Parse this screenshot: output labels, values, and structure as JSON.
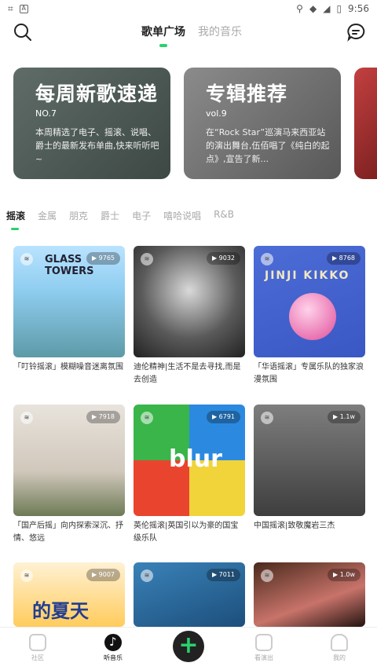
{
  "status": {
    "time": "9:56"
  },
  "header": {
    "tabs": [
      {
        "label": "歌单广场"
      },
      {
        "label": "我的音乐"
      }
    ]
  },
  "banners": [
    {
      "title": "每周新歌速递",
      "no": "NO.7",
      "desc": "本周精选了电子、摇滚、说唱、爵士的最新发布单曲,快来听听吧~"
    },
    {
      "title": "专辑推荐",
      "no": "vol.9",
      "desc": "在“Rock Star”巡演马来西亚站的演出舞台,伍佰唱了《纯白的起点》,宣告了新..."
    }
  ],
  "genres": [
    "摇滚",
    "金属",
    "朋克",
    "爵士",
    "电子",
    "嘻哈说唱",
    "R&B"
  ],
  "cards": [
    {
      "plays": "9765",
      "title": "「叮铃摇滚」模糊噪音迷离氛围",
      "cover_text": "GLASS TOWERS"
    },
    {
      "plays": "9032",
      "title": "迪伦精神|生活不是去寻找,而是去创造"
    },
    {
      "plays": "8768",
      "title": "「华语摇滚」专属乐队的独家浪漫氛围",
      "cover_text": "JINJI KIKKO"
    },
    {
      "plays": "7918",
      "title": "「国产后摇」向内探索深沉、抒情、悠远"
    },
    {
      "plays": "6791",
      "title": "英伦摇滚|英国引以为豪的国宝级乐队",
      "cover_text": "blur"
    },
    {
      "plays": "1.1w",
      "title": "中国摇滚|致敬魔岩三杰"
    },
    {
      "plays": "9007",
      "title": "",
      "cover_text": "的夏天"
    },
    {
      "plays": "7011",
      "title": ""
    },
    {
      "plays": "1.0w",
      "title": ""
    }
  ],
  "nav": [
    {
      "label": "社区"
    },
    {
      "label": "听音乐"
    },
    {
      "label": "看演出"
    },
    {
      "label": "我的"
    }
  ]
}
